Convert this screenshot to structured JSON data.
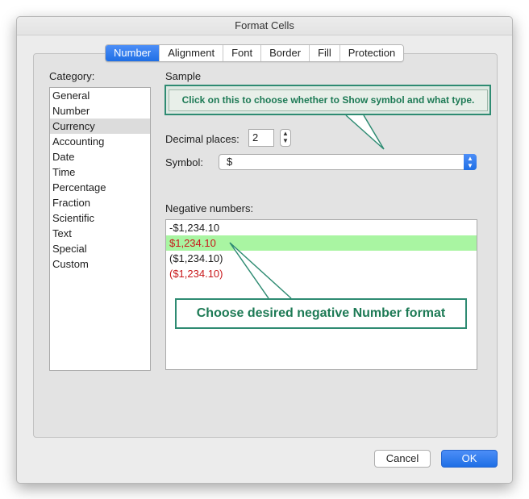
{
  "window": {
    "title": "Format Cells"
  },
  "tabs": [
    {
      "label": "Number",
      "active": true
    },
    {
      "label": "Alignment"
    },
    {
      "label": "Font"
    },
    {
      "label": "Border"
    },
    {
      "label": "Fill"
    },
    {
      "label": "Protection"
    }
  ],
  "category": {
    "label": "Category:",
    "items": [
      "General",
      "Number",
      "Currency",
      "Accounting",
      "Date",
      "Time",
      "Percentage",
      "Fraction",
      "Scientific",
      "Text",
      "Special",
      "Custom"
    ],
    "selected": "Currency"
  },
  "sample": {
    "label": "Sample"
  },
  "callouts": {
    "symbol_hint": "Click on this to choose whether to Show symbol and what type.",
    "negative_hint": "Choose desired negative Number format"
  },
  "decimal": {
    "label": "Decimal places:",
    "value": "2"
  },
  "symbol": {
    "label": "Symbol:",
    "value": "$"
  },
  "negative": {
    "label": "Negative numbers:",
    "items": [
      {
        "text": "-$1,234.10",
        "color": "#1d1d1d"
      },
      {
        "text": "$1,234.10",
        "color": "#c8171a",
        "selected": true
      },
      {
        "text": "($1,234.10)",
        "color": "#1d1d1d"
      },
      {
        "text": "($1,234.10)",
        "color": "#c8171a"
      }
    ]
  },
  "buttons": {
    "cancel": "Cancel",
    "ok": "OK"
  },
  "colors": {
    "accent": "#1f6fe5",
    "callout_green": "#2e8b72",
    "highlight": "#a9f5a2",
    "negative_red": "#c8171a"
  }
}
